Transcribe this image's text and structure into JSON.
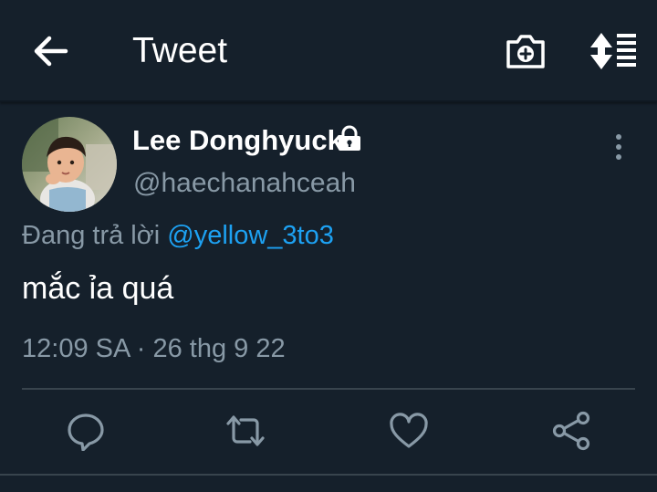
{
  "header": {
    "title": "Tweet",
    "back_icon": "arrow-left-icon",
    "camera_icon": "camera-plus-icon",
    "sort_icon": "sort-icon"
  },
  "tweet": {
    "author": {
      "display_name": "Lee Donghyuck",
      "handle": "@haechanahceah",
      "protected_icon": "lock-icon"
    },
    "reply_prefix": "Đang trả lời",
    "reply_to": "@yellow_3to3",
    "text": "mắc ỉa quá",
    "timestamp": "12:09 SA · 26 thg 9 22"
  },
  "actions": [
    {
      "name": "reply",
      "icon": "reply-icon"
    },
    {
      "name": "retweet",
      "icon": "retweet-icon"
    },
    {
      "name": "like",
      "icon": "heart-icon"
    },
    {
      "name": "share",
      "icon": "share-icon"
    }
  ],
  "colors": {
    "background": "#15202b",
    "secondary_text": "#8899a6",
    "accent": "#1da1f2",
    "divider": "#38444d"
  }
}
